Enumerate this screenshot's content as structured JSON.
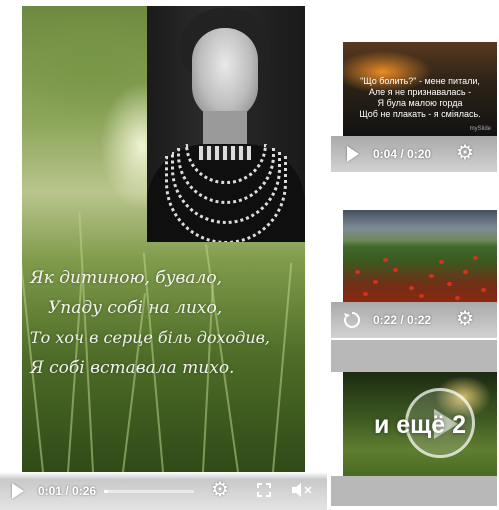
{
  "main_video": {
    "poem_lines": [
      "Як дитиною, бувало,",
      "Упаду собі на лихо,",
      "То хоч в серце біль доходив,",
      "Я собі вставала тихо."
    ],
    "time": "0:01 / 0:26",
    "progress": 0.04,
    "play_icon": "play-icon",
    "settings_icon": "gear-icon",
    "fullscreen_icon": "fullscreen-icon",
    "mute_icon": "volume-muted-icon"
  },
  "side_videos": [
    {
      "overlay_text": [
        "\"Що болить?\" - мене питали,",
        "Але я не признавалась -",
        "Я була малою горда",
        "Щоб не плакать - я сміялась."
      ],
      "watermark": "mySlide",
      "time": "0:04 / 0:20",
      "button_icon": "play-icon"
    },
    {
      "time": "0:22 / 0:22",
      "button_icon": "replay-icon"
    },
    {
      "more_label": "и ещё 2"
    }
  ],
  "colors": {
    "controls_bg": "#d2d2d2",
    "control_fg": "#ffffff",
    "poppy": "#d9301a"
  }
}
